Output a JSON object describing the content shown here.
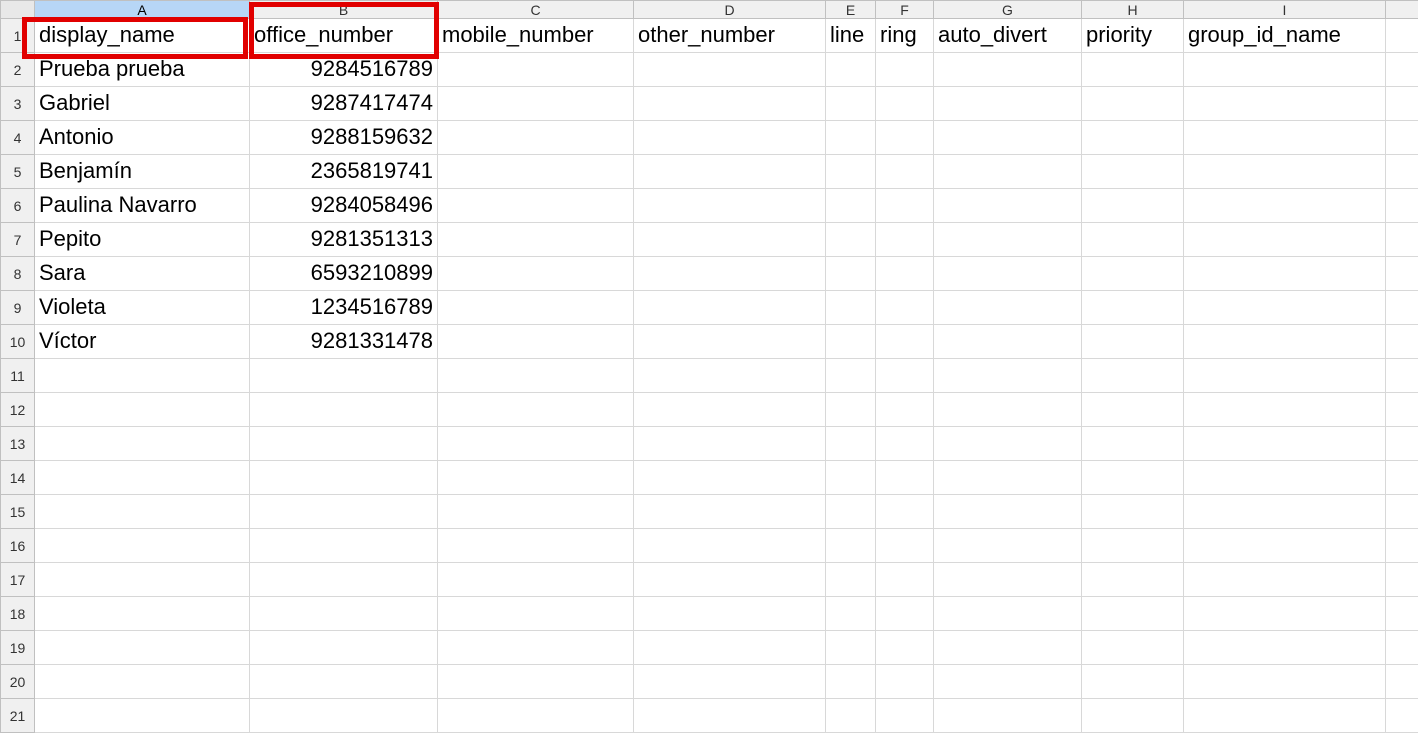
{
  "columns": {
    "letters": [
      "A",
      "B",
      "C",
      "D",
      "E",
      "F",
      "G",
      "H",
      "I"
    ],
    "selected": "A"
  },
  "row_count": 21,
  "chart_data": {
    "type": "table",
    "headers": [
      "display_name",
      "office_number",
      "mobile_number",
      "other_number",
      "line",
      "ring",
      "auto_divert",
      "priority",
      "group_id_name"
    ],
    "rows": [
      [
        "Prueba prueba",
        "9284516789",
        "",
        "",
        "",
        "",
        "",
        "",
        ""
      ],
      [
        "Gabriel",
        "9287417474",
        "",
        "",
        "",
        "",
        "",
        "",
        ""
      ],
      [
        "Antonio",
        "9288159632",
        "",
        "",
        "",
        "",
        "",
        "",
        ""
      ],
      [
        "Benjamín",
        "2365819741",
        "",
        "",
        "",
        "",
        "",
        "",
        ""
      ],
      [
        "Paulina Navarro",
        "9284058496",
        "",
        "",
        "",
        "",
        "",
        "",
        ""
      ],
      [
        "Pepito",
        "9281351313",
        "",
        "",
        "",
        "",
        "",
        "",
        ""
      ],
      [
        "Sara",
        "6593210899",
        "",
        "",
        "",
        "",
        "",
        "",
        ""
      ],
      [
        "Violeta",
        "1234516789",
        "",
        "",
        "",
        "",
        "",
        "",
        ""
      ],
      [
        "Víctor",
        "9281331478",
        "",
        "",
        "",
        "",
        "",
        "",
        ""
      ]
    ]
  }
}
